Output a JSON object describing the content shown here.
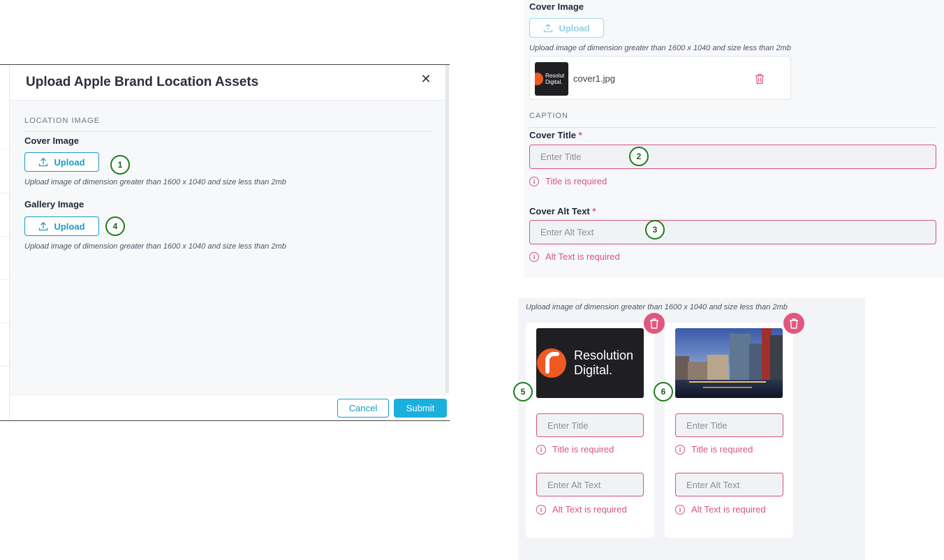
{
  "modal": {
    "title": "Upload Apple Brand Location Assets",
    "section_location": "LOCATION IMAGE",
    "cover_label": "Cover Image",
    "gallery_label": "Gallery Image",
    "upload_label": "Upload",
    "hint": "Upload image of dimension greater than 1600 x 1040 and size less than 2mb",
    "cancel_label": "Cancel",
    "submit_label": "Submit",
    "close_glyph": "✕"
  },
  "cover_panel": {
    "cover_label": "Cover Image",
    "upload_label": "Upload",
    "hint": "Upload image of dimension greater than 1600 x 1040 and size less than 2mb",
    "file_name": "cover1.jpg",
    "thumb_line1": "Resolut",
    "thumb_line2": "Digital.",
    "section_caption": "CAPTION",
    "cover_title_label": "Cover Title",
    "cover_title_placeholder": "Enter Title",
    "title_error": "Title is required",
    "cover_alt_label": "Cover Alt Text",
    "cover_alt_placeholder": "Enter Alt Text",
    "alt_error": "Alt Text is required",
    "required_mark": "*"
  },
  "gallery_panel": {
    "hint": "Upload image of dimension greater than 1600 x 1040 and size less than 2mb",
    "items": [
      {
        "image": "resolution-digital-logo",
        "logo_line1": "Resolution",
        "logo_line2": "Digital.",
        "title_placeholder": "Enter Title",
        "title_error": "Title is required",
        "alt_placeholder": "Enter Alt Text",
        "alt_error": "Alt Text is required"
      },
      {
        "image": "city-waterfront-photo",
        "title_placeholder": "Enter Title",
        "title_error": "Title is required",
        "alt_placeholder": "Enter Alt Text",
        "alt_error": "Alt Text is required"
      }
    ]
  },
  "markers": [
    "1",
    "2",
    "3",
    "4",
    "5",
    "6"
  ],
  "colors": {
    "accent": "#1a9bc7",
    "submit": "#1ab0de",
    "error": "#d6547f",
    "marker": "#1d7d1d",
    "delete": "#e0577f"
  }
}
